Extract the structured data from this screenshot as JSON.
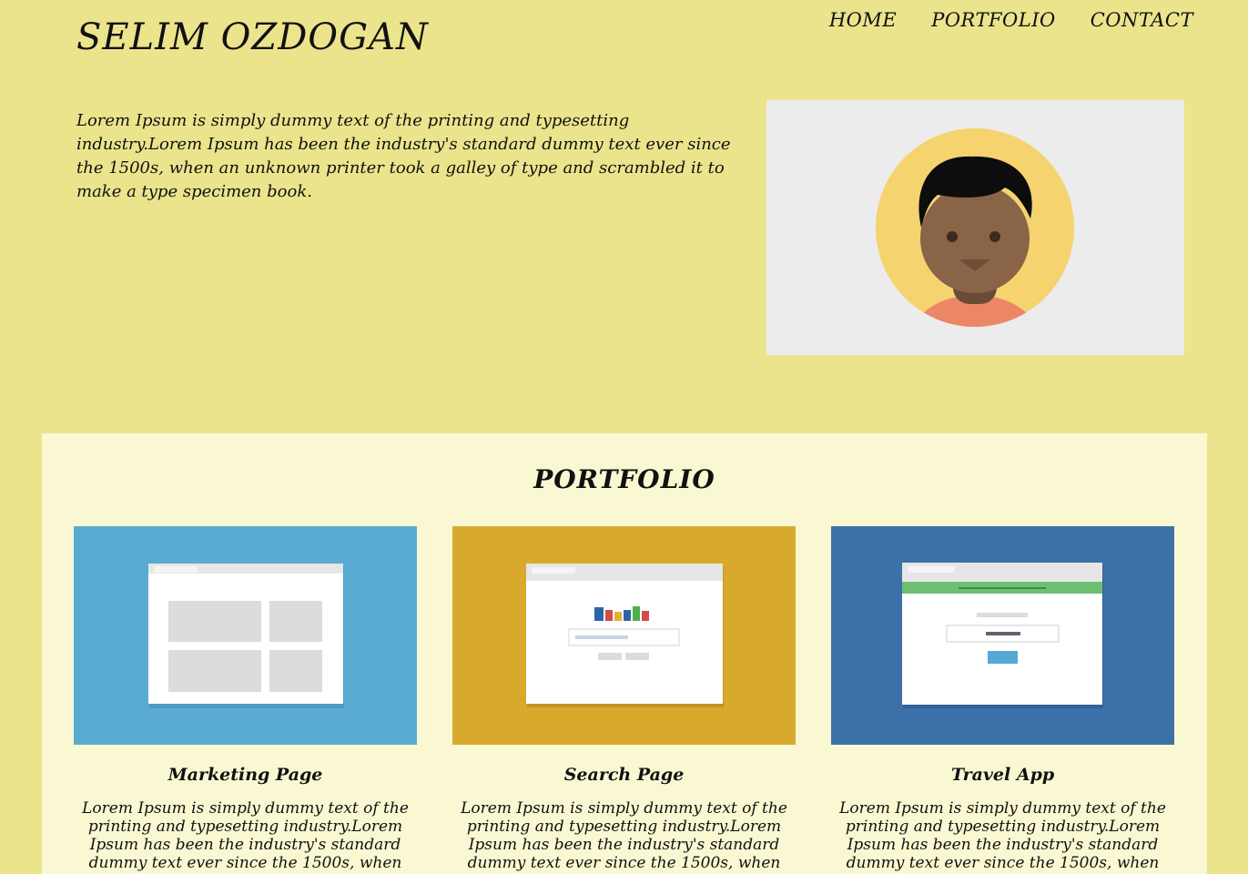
{
  "header": {
    "brand": "SELIM OZDOGAN",
    "nav": [
      "HOME",
      "PORTFOLIO",
      "CONTACT"
    ]
  },
  "intro": {
    "text": "Lorem Ipsum is simply dummy text of the printing and typesetting industry.Lorem Ipsum has been the industry's standard dummy text ever since the 1500s, when an unknown printer took a galley of type and scrambled it to make a type specimen book."
  },
  "portfolio": {
    "title": "PORTFOLIO",
    "cards": [
      {
        "title": "Marketing Page",
        "text": "Lorem Ipsum is simply dummy text of the printing and typesetting industry.Lorem Ipsum has been the industry's standard dummy text ever since the 1500s, when",
        "icon": "marketing-page-thumbnail",
        "bg": "#59abd2"
      },
      {
        "title": "Search Page",
        "text": "Lorem Ipsum is simply dummy text of the printing and typesetting industry.Lorem Ipsum has been the industry's standard dummy text ever since the 1500s, when",
        "icon": "search-page-thumbnail",
        "bg": "#d8a92d"
      },
      {
        "title": "Travel App",
        "text": "Lorem Ipsum is simply dummy text of the printing and typesetting industry.Lorem Ipsum has been the industry's standard dummy text ever since the 1500s, when",
        "icon": "travel-app-thumbnail",
        "bg": "#3c70a8"
      }
    ]
  },
  "colors": {
    "page_bg": "#ebe48d",
    "section_bg": "#f9f8d2",
    "avatar_panel": "#ececec"
  }
}
